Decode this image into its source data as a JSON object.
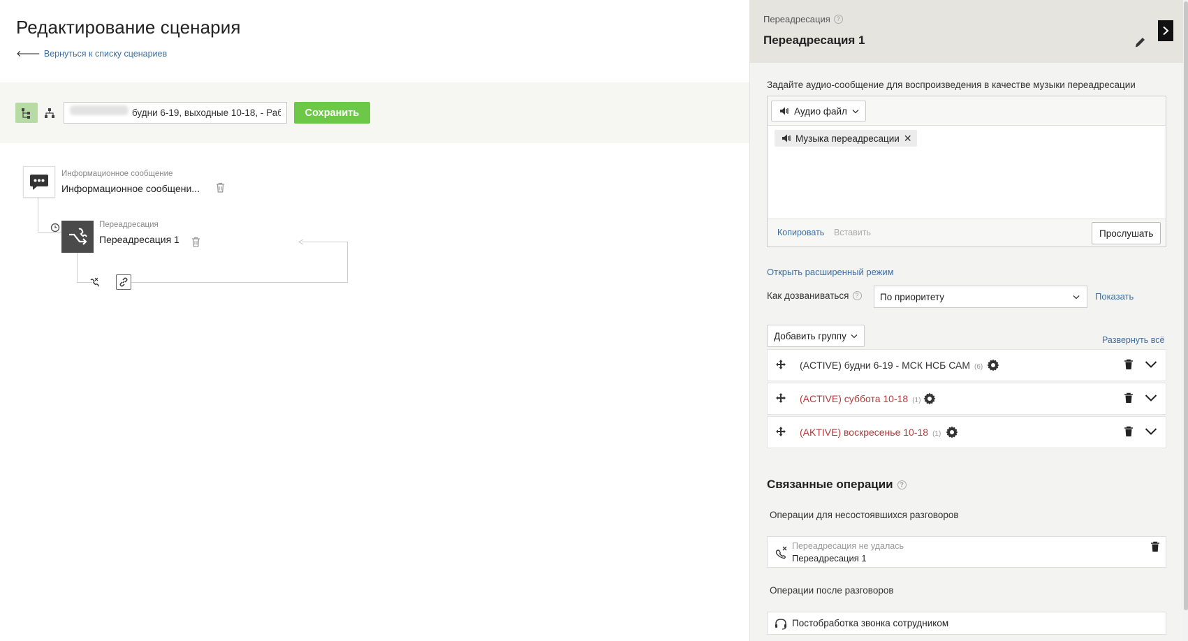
{
  "header": {
    "title": "Редактирование сценария",
    "back_arrow": "🡐",
    "back_link": "Вернуться к списку сценариев"
  },
  "toolbar": {
    "view_tree_icon": "tree-view-icon",
    "view_hierarchy_icon": "hierarchy-view-icon",
    "scenario_name_value": "будни 6-19, выходные 10-18, - Раб",
    "save_label": "Сохранить",
    "save_color": "#6dc847"
  },
  "canvas": {
    "info_node": {
      "type": "Информационное сообщение",
      "name": "Информационное сообщени..."
    },
    "redirect_node": {
      "type": "Переадресация",
      "name": "Переадресация 1"
    }
  },
  "panel": {
    "type_label": "Переадресация",
    "help_mark": "?",
    "title": "Переадресация 1",
    "audio_label": "Задайте аудио-сообщение для воспроизведения в качестве музыки переадресации",
    "audio_dropdown": "Аудио файл",
    "audio_tag": "Музыка переадресации",
    "tag_remove": "✕",
    "copy_link": "Копировать",
    "paste_link": "Вставить",
    "listen_button": "Прослушать",
    "advanced_link": "Открыть расширенный режим",
    "dial_label": "Как дозваниваться",
    "dial_value": "По приоритету",
    "show_link": "Показать",
    "add_group_button": "Добавить группу",
    "expand_all_link": "Развернуть всё",
    "groups": [
      {
        "label": "(ACTIVE) будни 6-19 - МСК НСБ САМ",
        "count": "(6)",
        "color": "#333333"
      },
      {
        "label": "(ACTIVE) суббота 10-18",
        "count": "(1)",
        "color": "#b33a3a"
      },
      {
        "label": "(AKTIVE) воскресенье 10-18",
        "count": "(1)",
        "color": "#b33a3a"
      }
    ],
    "linked_title": "Связанные операции",
    "failed_ops_label": "Операции для несостоявшихся разговоров",
    "failed_op": {
      "type": "Переадресация не удалась",
      "name": "Переадресация 1"
    },
    "after_ops_label": "Операции после разговоров",
    "after_op": "Постобработка звонка сотрудником"
  }
}
